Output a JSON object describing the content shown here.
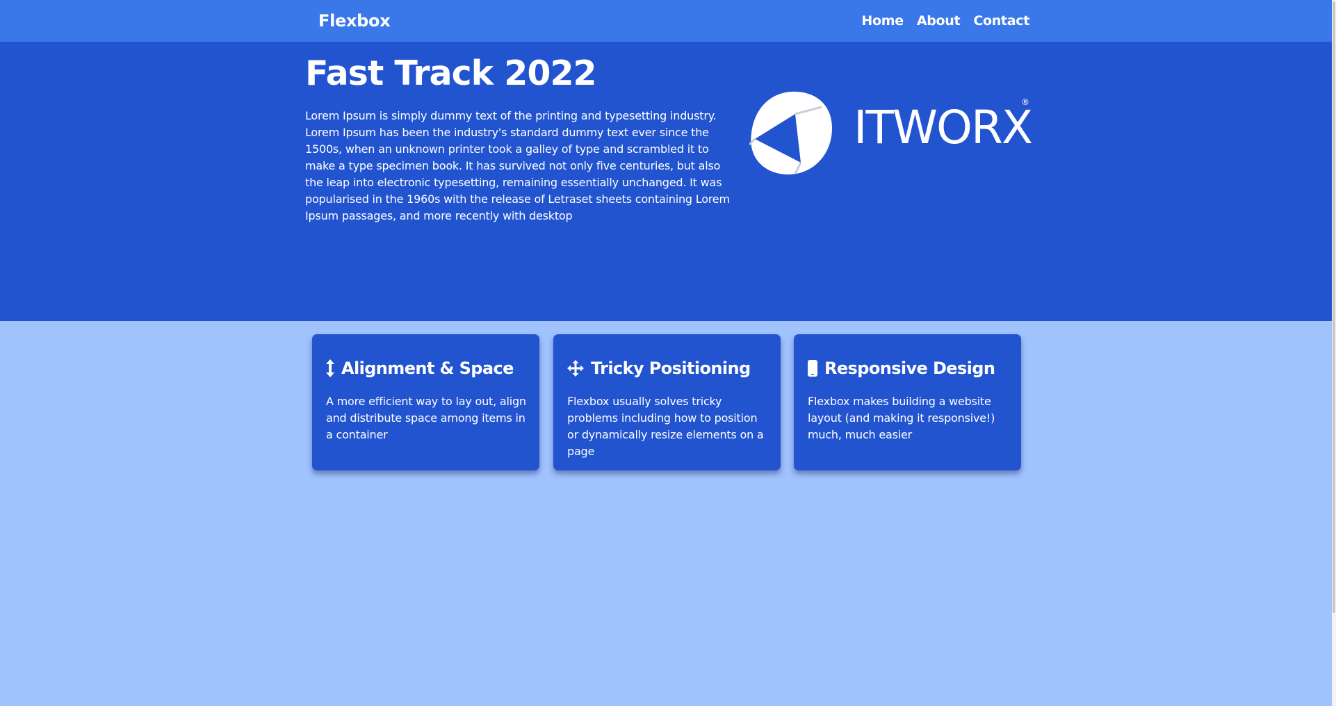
{
  "navbar": {
    "brand": "Flexbox",
    "links": [
      "Home",
      "About",
      "Contact"
    ]
  },
  "hero": {
    "title": "Fast Track 2022",
    "text": "Lorem Ipsum is simply dummy text of the printing and typesetting industry. Lorem Ipsum has been the industry's standard dummy text ever since the 1500s, when an unknown printer took a galley of type and scrambled it to make a type specimen book. It has survived not only five centuries, but also the leap into electronic typesetting, remaining essentially unchanged. It was popularised in the 1960s with the release of Letraset sheets containing Lorem Ipsum passages, and more recently with desktop",
    "logo": {
      "wordmark": "ITWORX",
      "registered": "®"
    }
  },
  "features": [
    {
      "icon": "arrows-vertical-icon",
      "title": "Alignment & Space",
      "text": "A more efficient way to lay out, align and distribute space among items in a container"
    },
    {
      "icon": "arrows-move-icon",
      "title": "Tricky Positioning",
      "text": "Flexbox usually solves tricky problems including how to position or dynamically resize elements on a page"
    },
    {
      "icon": "mobile-phone-icon",
      "title": "Responsive Design",
      "text": "Flexbox makes building a website layout (and making it responsive!) much, much easier"
    }
  ],
  "colors": {
    "navbar": "#3a78ea",
    "hero": "#2254d0",
    "page_background": "#a0c2fd",
    "card": "#2254d0",
    "text": "#ffffff"
  }
}
